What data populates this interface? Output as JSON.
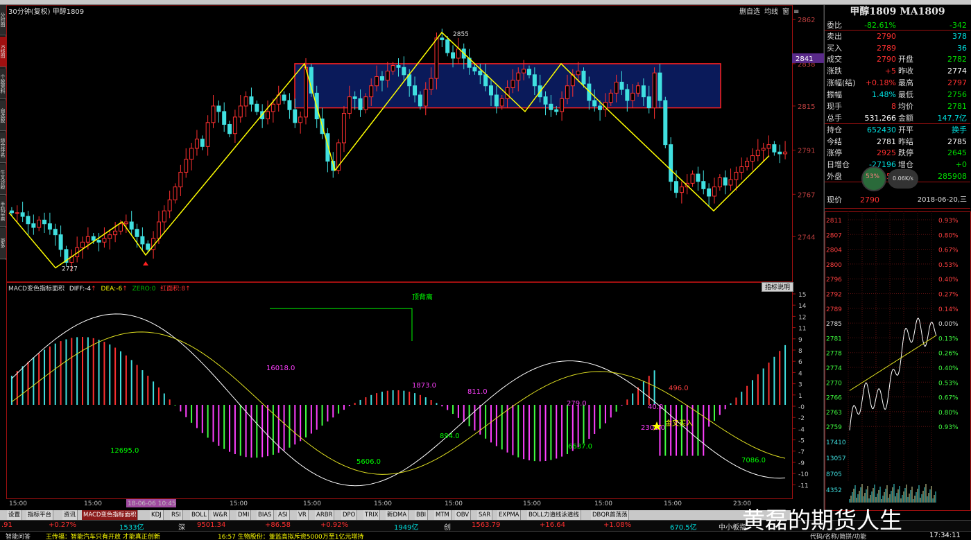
{
  "chart_title": "30分钟(复权)  甲醇1809",
  "chart_buttons": [
    "删自选",
    "均线",
    "窗",
    "≡"
  ],
  "price_axis": [
    {
      "label": "2862",
      "price": 2862
    },
    {
      "label": "2838",
      "price": 2838
    },
    {
      "label": "2815",
      "price": 2815
    },
    {
      "label": "2791",
      "price": 2791
    },
    {
      "label": "2767",
      "price": 2767
    },
    {
      "label": "2744",
      "price": 2744
    }
  ],
  "price_marker": "2841",
  "price_labels": {
    "high": "2855",
    "low": "2727"
  },
  "macd_axis": [
    "15",
    "14",
    "12",
    "11",
    "9",
    "8",
    "6",
    "4",
    "3",
    "1",
    "-0",
    "-2",
    "-4",
    "-5",
    "-7",
    "-9",
    "-10",
    "-11"
  ],
  "indicator": {
    "name": "MACD变色指标面积",
    "diff_label": "DIFF:",
    "diff": "-4",
    "dea_label": "DEA:",
    "dea": "-6",
    "zero_label": "ZERO:",
    "zero": "0",
    "area_label": "红面积:",
    "area": "8",
    "button": "指标说明"
  },
  "macd_annotations": [
    {
      "text": "顶背离",
      "color": "#00ff00"
    },
    {
      "text": "16018.0",
      "color": "#ff40ff"
    },
    {
      "text": "1873.0",
      "color": "#ff40ff"
    },
    {
      "text": "811.0",
      "color": "#ff40ff"
    },
    {
      "text": "496.0",
      "color": "#ff4040"
    },
    {
      "text": "12695.0",
      "color": "#00ff00"
    },
    {
      "text": "5606.0",
      "color": "#00ff00"
    },
    {
      "text": "894.0",
      "color": "#00ff00"
    },
    {
      "text": "6637.0",
      "color": "#00ff00"
    },
    {
      "text": "7086.0",
      "color": "#00ff00"
    },
    {
      "text": "40.0",
      "color": "#ff40ff"
    },
    {
      "text": "2301.0",
      "color": "#ff40ff"
    },
    {
      "text": "金叉买入",
      "color": "#ffff00"
    },
    {
      "text": "279.0",
      "color": "#ff40ff"
    }
  ],
  "time_axis": [
    "15:00",
    "15:00",
    "18-06-06 10:45",
    "15:00",
    "15:00",
    "15:00",
    "15:00",
    "15:00",
    "15:00",
    "15:00",
    "23:00"
  ],
  "bottom_tabs": [
    "设置",
    "指标平台",
    "资讯",
    "MACD变色指标面积",
    "KDJ",
    "RSI",
    "BOLL",
    "W&R",
    "DMI",
    "BIAS",
    "ASI",
    "VR",
    "ARBR",
    "DPO",
    "TRIX",
    "新DMA",
    "BBI",
    "MTM",
    "OBV",
    "SAR",
    "EXPMA",
    "BOLL力道线泳道线",
    "DBQR首荡荡"
  ],
  "status": {
    "a_val": ".91",
    "a_pct": "+0.27%",
    "a_amt": "1533亿",
    "sz_label": "深",
    "sz_val": "9501.34",
    "sz_chg": "+86.58",
    "sz_pct": "+0.92%",
    "sz_amt": "1949亿",
    "cy_label": "创",
    "cy_val": "1563.79",
    "cy_chg": "+16.64",
    "cy_pct": "+1.08%",
    "cy_amt": "670.5亿",
    "zx_label": "中小板指"
  },
  "news": {
    "btn": "智能问答",
    "n1": "王传福：智能汽车只有开放 才能真正创新",
    "n2": "16:57 生物股份：董监高拟斥资5000万至1亿元增持",
    "right": "代码/名称/简拼/功能",
    "clock": "17:34:11"
  },
  "quote": {
    "title": "甲醇1809 MA1809",
    "rows": [
      {
        "l": "委比",
        "v": "-82.61%",
        "vc": "#00e000",
        "l2": "",
        "v2": "-342",
        "v2c": "#00e000"
      },
      {
        "l": "卖出",
        "v": "2790",
        "vc": "#ff3030",
        "l2": "",
        "v2": "378",
        "v2c": "#00e0e0"
      },
      {
        "l": "买入",
        "v": "2789",
        "vc": "#ff3030",
        "l2": "",
        "v2": "36",
        "v2c": "#00e0e0"
      },
      {
        "l": "成交",
        "v": "2790",
        "vc": "#ff3030",
        "l2": "开盘",
        "v2": "2782",
        "v2c": "#00e000"
      },
      {
        "l": "涨跌",
        "v": "+5",
        "vc": "#ff3030",
        "l2": "昨收",
        "v2": "2774",
        "v2c": "#ffffff"
      },
      {
        "l": "涨幅(结)",
        "v": "+0.18%",
        "vc": "#ff3030",
        "l2": "最高",
        "v2": "2797",
        "v2c": "#ff3030"
      },
      {
        "l": "振幅",
        "v": "1.48%",
        "vc": "#00e0e0",
        "l2": "最低",
        "v2": "2756",
        "v2c": "#00e000"
      },
      {
        "l": "现手",
        "v": "8",
        "vc": "#ff3030",
        "l2": "均价",
        "v2": "2781",
        "v2c": "#00e000"
      },
      {
        "l": "总手",
        "v": "531,266",
        "vc": "#ffffff",
        "l2": "金额",
        "v2": "147.7亿",
        "v2c": "#00e0e0"
      },
      {
        "l": "持仓",
        "v": "652430",
        "vc": "#00e0e0",
        "l2": "开平",
        "v2": "换手",
        "v2c": "#00e0e0"
      },
      {
        "l": "今结",
        "v": "2781",
        "vc": "#ffffff",
        "l2": "昨结",
        "v2": "2785",
        "v2c": "#ffffff"
      },
      {
        "l": "涨停",
        "v": "2925",
        "vc": "#ff3030",
        "l2": "跌停",
        "v2": "2645",
        "v2c": "#00e000"
      },
      {
        "l": "日增仓",
        "v": "-27196",
        "vc": "#00e0e0",
        "l2": "增仓",
        "v2": "+0",
        "v2c": "#00e000"
      },
      {
        "l": "外盘",
        "v": "245153",
        "vc": "#ff3030",
        "l2": "内盘",
        "v2": "285908",
        "v2c": "#00e000"
      }
    ],
    "current_label": "现价",
    "current": "2790",
    "date": "2018-06-20,三",
    "bubble_pct": "53%",
    "bubble_speed": "0.06K/s"
  },
  "tick_axis_left": [
    "2811",
    "2807",
    "2804",
    "2800",
    "2796",
    "2792",
    "2789",
    "2785",
    "2781",
    "2778",
    "2774",
    "2770",
    "2766",
    "2763",
    "2759"
  ],
  "tick_axis_right": [
    "0.93%",
    "0.80%",
    "0.67%",
    "0.53%",
    "0.40%",
    "0.27%",
    "0.14%",
    "0.00%",
    "0.13%",
    "0.26%",
    "0.40%",
    "0.53%",
    "0.67%",
    "0.80%",
    "0.93%"
  ],
  "vol_axis": [
    "17410",
    "13057",
    "8705",
    "4352"
  ],
  "left_tabs": [
    "分时图",
    "K线图",
    "个股资料",
    "自选股",
    "综合排名",
    "牛叉诊股",
    "手机买卖",
    "更多"
  ],
  "watermark": "黄磊的期货人生",
  "chart_data": {
    "type": "candlestick",
    "ylim": [
      2720,
      2870
    ],
    "closes": [
      2757,
      2757,
      2755,
      2751,
      2749,
      2753,
      2751,
      2748,
      2745,
      2737,
      2730,
      2733,
      2738,
      2741,
      2744,
      2742,
      2741,
      2743,
      2745,
      2747,
      2751,
      2752,
      2748,
      2744,
      2740,
      2737,
      2743,
      2752,
      2758,
      2764,
      2771,
      2779,
      2786,
      2792,
      2797,
      2793,
      2806,
      2815,
      2812,
      2805,
      2800,
      2809,
      2815,
      2820,
      2816,
      2812,
      2808,
      2812,
      2816,
      2821,
      2818,
      2813,
      2806,
      2809,
      2836,
      2822,
      2808,
      2800,
      2785,
      2780,
      2795,
      2811,
      2820,
      2819,
      2813,
      2820,
      2826,
      2831,
      2829,
      2834,
      2837,
      2836,
      2832,
      2826,
      2821,
      2815,
      2824,
      2830,
      2852,
      2851,
      2844,
      2841,
      2846,
      2841,
      2836,
      2834,
      2832,
      2826,
      2821,
      2815,
      2819,
      2825,
      2829,
      2833,
      2835,
      2832,
      2826,
      2820,
      2816,
      2813,
      2812,
      2819,
      2826,
      2832,
      2834,
      2827,
      2818,
      2815,
      2813,
      2817,
      2822,
      2828,
      2824,
      2818,
      2822,
      2826,
      2820,
      2814,
      2833,
      2818,
      2794,
      2774,
      2768,
      2771,
      2773,
      2778,
      2774,
      2770,
      2766,
      2771,
      2776,
      2772,
      2775,
      2779,
      2782,
      2785,
      2788,
      2791,
      2792,
      2794,
      2790,
      2789,
      2790
    ],
    "zigzag": [
      2757,
      2727,
      2752,
      2734,
      2838,
      2780,
      2855,
      2812,
      2838,
      2812,
      2758,
      2788
    ]
  }
}
